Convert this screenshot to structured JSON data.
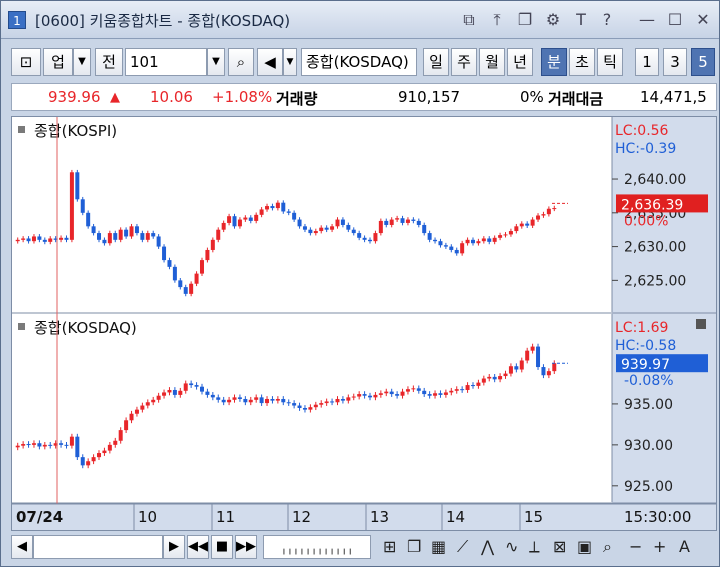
{
  "window": {
    "number": "1",
    "title": "[0600] 키움종합차트 - 종합(KOSDAQ)"
  },
  "toolbar": {
    "market_label": "업",
    "prev_label": "전",
    "code_value": "101",
    "search_icon": "magnifier-icon",
    "sound_icon": "speaker-icon",
    "index_name": "종합(KOSDAQ)",
    "periods": [
      "일",
      "주",
      "월",
      "년",
      "분",
      "초",
      "틱"
    ],
    "active_period": "분",
    "intervals": [
      "1",
      "3",
      "5"
    ],
    "active_interval": "5"
  },
  "quote": {
    "price": "939.96",
    "change": "10.06",
    "change_pct": "+1.08%",
    "volume_label": "거래량",
    "volume": "910,157",
    "volume_pct": "0%",
    "amount_label": "거래대금",
    "amount": "14,471,5"
  },
  "colors": {
    "up": "#e8262a",
    "down": "#1f5fd6",
    "axis_bg": "#d2dcec",
    "price_box": "#e02020",
    "price_box2": "#1f5fd6"
  },
  "chart_data": [
    {
      "type": "candlestick",
      "title": "종합(KOSPI)",
      "lc": "LC:0.56",
      "hc": "HC:-0.39",
      "current": "2,636.39",
      "current_pct": "0.00%",
      "ticks": [
        "2,640.00",
        "2,635.00",
        "2,630.00",
        "2,625.00"
      ],
      "ylim": [
        2621.5,
        2648
      ],
      "closes": [
        2631.0,
        2631.2,
        2630.8,
        2631.5,
        2631.0,
        2630.7,
        2631.2,
        2631.0,
        2631.3,
        2631.0,
        2641,
        2637,
        2635,
        2633,
        2632,
        2631,
        2630.5,
        2632,
        2631,
        2632.5,
        2631.5,
        2633,
        2632,
        2631,
        2632,
        2631.5,
        2630,
        2628,
        2627,
        2625,
        2624,
        2623,
        2624.5,
        2626,
        2628,
        2629.5,
        2631,
        2632.5,
        2633.5,
        2634.5,
        2633,
        2634,
        2634.3,
        2633.8,
        2634.7,
        2635.5,
        2636,
        2635.7,
        2636.5,
        2635.2,
        2635,
        2634,
        2633,
        2632.5,
        2632,
        2632.3,
        2632.8,
        2632.5,
        2633,
        2634,
        2633.2,
        2632.5,
        2632,
        2631.3,
        2631,
        2630.8,
        2632,
        2633.8,
        2633.2,
        2634,
        2634.2,
        2633.5,
        2634,
        2633.8,
        2633.2,
        2632,
        2631,
        2630.8,
        2630.2,
        2630,
        2629.5,
        2629,
        2630.5,
        2631,
        2630.5,
        2630.8,
        2631.2,
        2630.7,
        2631.3,
        2631.7,
        2631.8,
        2632.3,
        2633,
        2633.4,
        2633.1,
        2634,
        2634.6,
        2634.8,
        2635.6,
        2635.7
      ],
      "day_ticks": [
        "07/24",
        "10",
        "11",
        "12",
        "13",
        "14",
        "15"
      ]
    },
    {
      "type": "candlestick",
      "title": "종합(KOSDAQ)",
      "lc": "LC:1.69",
      "hc": "HC:-0.58",
      "current": "939.97",
      "current_pct": "-0.08%",
      "ticks": [
        "935.00",
        "930.00",
        "925.00"
      ],
      "ylim": [
        924,
        945
      ],
      "closes": [
        929.9,
        930.1,
        930.0,
        930.2,
        929.8,
        930.0,
        929.9,
        930.2,
        930.0,
        929.9,
        931,
        928.5,
        927.5,
        928,
        928.5,
        929,
        929.3,
        930,
        930.5,
        931.8,
        933,
        933.8,
        934.3,
        934.8,
        935.2,
        935.5,
        936,
        936.4,
        936.7,
        936.1,
        936.6,
        937.5,
        937.3,
        937.1,
        936.5,
        936.1,
        935.8,
        935.5,
        935.2,
        935.5,
        935.8,
        935.6,
        935.2,
        935.5,
        935.8,
        935.1,
        935.6,
        935.4,
        935.6,
        935.2,
        935.1,
        934.8,
        934.5,
        934.3,
        934.6,
        934.9,
        935.1,
        935.3,
        935.2,
        935.6,
        935.4,
        935.8,
        935.9,
        936.2,
        936.0,
        935.8,
        936.1,
        936.3,
        936.5,
        936.2,
        936.0,
        936.5,
        936.8,
        936.9,
        936.6,
        936.2,
        936.0,
        936.3,
        936.1,
        936.4,
        936.6,
        936.8,
        936.7,
        937.3,
        937.2,
        937.6,
        938.1,
        938.3,
        938.0,
        938.4,
        938.7,
        939.6,
        939.2,
        940.3,
        941.5,
        942.0,
        939.5,
        938.5,
        939.0,
        939.97
      ],
      "day_ticks": [
        "07/24",
        "10",
        "11",
        "12",
        "13",
        "14",
        "15"
      ]
    }
  ],
  "time_axis": {
    "labels": [
      "07/24",
      "10",
      "11",
      "12",
      "13",
      "14",
      "15"
    ],
    "time": "15:30:00"
  }
}
